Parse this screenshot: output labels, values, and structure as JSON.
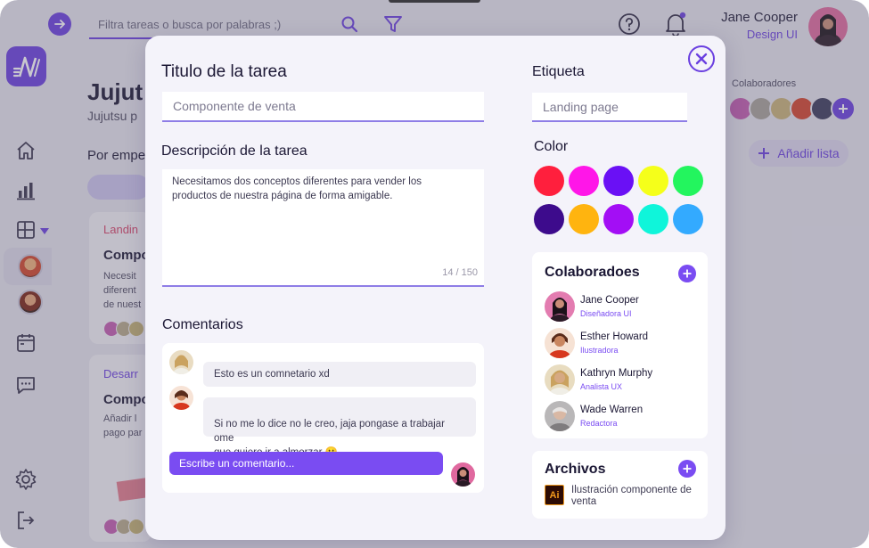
{
  "search": {
    "placeholder": "Filtra tareas o busca por palabras ;)"
  },
  "user": {
    "name": "Jane Cooper",
    "role": "Design UI"
  },
  "background": {
    "title": "Jujut",
    "subtitle": "Jujutsu p",
    "group_label": "Por empe",
    "cards": [
      {
        "tag": "Landin",
        "title": "Compo",
        "lines": [
          "Necesit",
          "diferent",
          "de nuest"
        ],
        "tag_color": "#d6446a"
      },
      {
        "tag": "Desarr",
        "title": "Compo",
        "lines": [
          "Añadir l",
          "pago par"
        ],
        "tag_color": "#6a3fe0"
      }
    ],
    "collaborators_label": "Colaboradores",
    "add_list_label": "Añadir lista"
  },
  "modal": {
    "task_title_label": "Titulo de la tarea",
    "task_title_placeholder": "Componente de venta",
    "description_label": "Descripción de la tarea",
    "description_text": "Necesitamos dos conceptos diferentes para vender los\nproductos de nuestra página de forma amigable.",
    "char_count": "14 / 150",
    "comments_label": "Comentarios",
    "comments": [
      {
        "text": "Esto es un comnetario xd"
      },
      {
        "text": "Si no me lo dice no le creo, jaja pongase a trabajar ome\nque quiero ir a almorzar 😮"
      }
    ],
    "comment_input_placeholder": "Escribe un comentario...",
    "tag_label": "Etiqueta",
    "tag_placeholder": "Landing page",
    "color_label": "Color",
    "colors": [
      "#ff1f3d",
      "#ff16e8",
      "#6a10f5",
      "#f5ff1a",
      "#23f55e",
      "#3d0b8c",
      "#ffb40f",
      "#a30ef5",
      "#0ff5da",
      "#33aaff"
    ],
    "collaborators_title": "Colaboradoes",
    "collaborators": [
      {
        "name": "Jane Cooper",
        "role": "Diseñadora UI"
      },
      {
        "name": "Esther Howard",
        "role": "Ilustradora"
      },
      {
        "name": "Kathryn Murphy",
        "role": "Analista UX"
      },
      {
        "name": "Wade Warren",
        "role": "Redactora"
      }
    ],
    "files_title": "Archivos",
    "files": [
      {
        "icon_label": "Ai",
        "name": "Ilustración componente de venta"
      }
    ]
  }
}
